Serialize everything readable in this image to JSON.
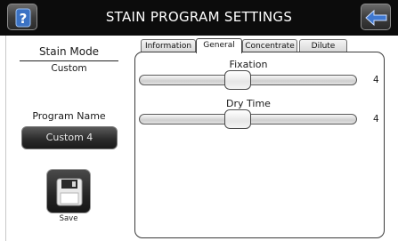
{
  "header": {
    "title": "STAIN PROGRAM SETTINGS",
    "help_icon": "question-mark-icon",
    "back_icon": "back-arrow-icon"
  },
  "left_panel": {
    "stain_mode_label": "Stain Mode",
    "stain_mode_value": "Custom",
    "program_name_label": "Program Name",
    "program_name_value": "Custom 4",
    "save_label": "Save",
    "save_icon": "floppy-disk-icon"
  },
  "tabs": [
    {
      "label": "Information",
      "active": false
    },
    {
      "label": "General",
      "active": true
    },
    {
      "label": "Concentrate",
      "active": false
    },
    {
      "label": "Dilute",
      "active": false
    }
  ],
  "settings": [
    {
      "label": "Fixation",
      "value": "4",
      "position_fraction": 0.4
    },
    {
      "label": "Dry Time",
      "value": "4",
      "position_fraction": 0.4
    }
  ],
  "colors": {
    "header_bg": "#0c0c0c",
    "help_accent": "#3b72c4",
    "back_accent": "#3f78d0"
  }
}
